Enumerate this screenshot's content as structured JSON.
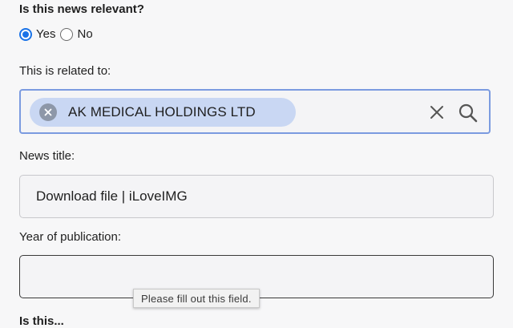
{
  "relevance": {
    "question": "Is this news relevant?",
    "options": [
      {
        "label": "Yes",
        "checked": true
      },
      {
        "label": "No",
        "checked": false
      }
    ]
  },
  "related": {
    "label": "This is related to:",
    "selected_chip": "AK MEDICAL HOLDINGS LTD",
    "icons": [
      "chip-remove-icon",
      "clear-icon",
      "search-icon"
    ]
  },
  "news_title": {
    "label": "News title:",
    "value": "Download file | iLoveIMG"
  },
  "year": {
    "label": "Year of publication:",
    "value": "",
    "validation_tooltip": "Please fill out this field."
  },
  "next_question_partial": "Is this...",
  "colors": {
    "accent": "#1a73e8",
    "chip_bg": "#c9d7f3",
    "focus_border": "#7b9be0"
  }
}
